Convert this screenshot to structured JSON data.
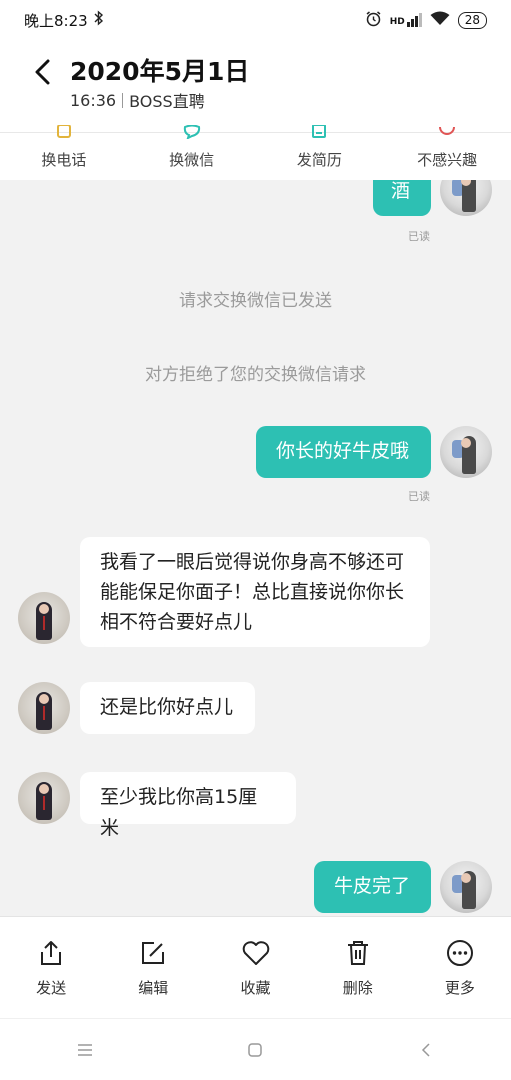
{
  "status_bar": {
    "time": "晚上8:23",
    "battery": "28",
    "network": "HD"
  },
  "header": {
    "title": "2020年5月1日",
    "time": "16:36",
    "source": "BOSS直聘"
  },
  "actions": [
    {
      "label": "换电话",
      "icon": "phone-icon"
    },
    {
      "label": "换微信",
      "icon": "wechat-icon"
    },
    {
      "label": "发简历",
      "icon": "resume-icon"
    },
    {
      "label": "不感兴趣",
      "icon": "not-interested-icon"
    }
  ],
  "messages": {
    "m1": {
      "text": "酒",
      "status": "已读"
    },
    "sys1": "请求交换微信已发送",
    "sys2": "对方拒绝了您的交换微信请求",
    "m2": {
      "text": "你长的好牛皮哦",
      "status": "已读"
    },
    "m3": {
      "lines": [
        "我看了一眼后觉得说你身高不够还可",
        "能能保足你面子！总比直接说你你长",
        "相不符合要好点儿"
      ]
    },
    "m4": {
      "text": "还是比你好点儿"
    },
    "m5": {
      "text": "至少我比你高15厘米"
    },
    "m6": {
      "text": "牛皮完了"
    }
  },
  "toolbar": [
    {
      "label": "发送",
      "icon": "share-icon"
    },
    {
      "label": "编辑",
      "icon": "edit-icon"
    },
    {
      "label": "收藏",
      "icon": "heart-icon"
    },
    {
      "label": "删除",
      "icon": "trash-icon"
    },
    {
      "label": "更多",
      "icon": "more-icon"
    }
  ],
  "colors": {
    "accent": "#2dc0b3",
    "background": "#f2f2f2",
    "system_text": "#9b9b9b"
  }
}
